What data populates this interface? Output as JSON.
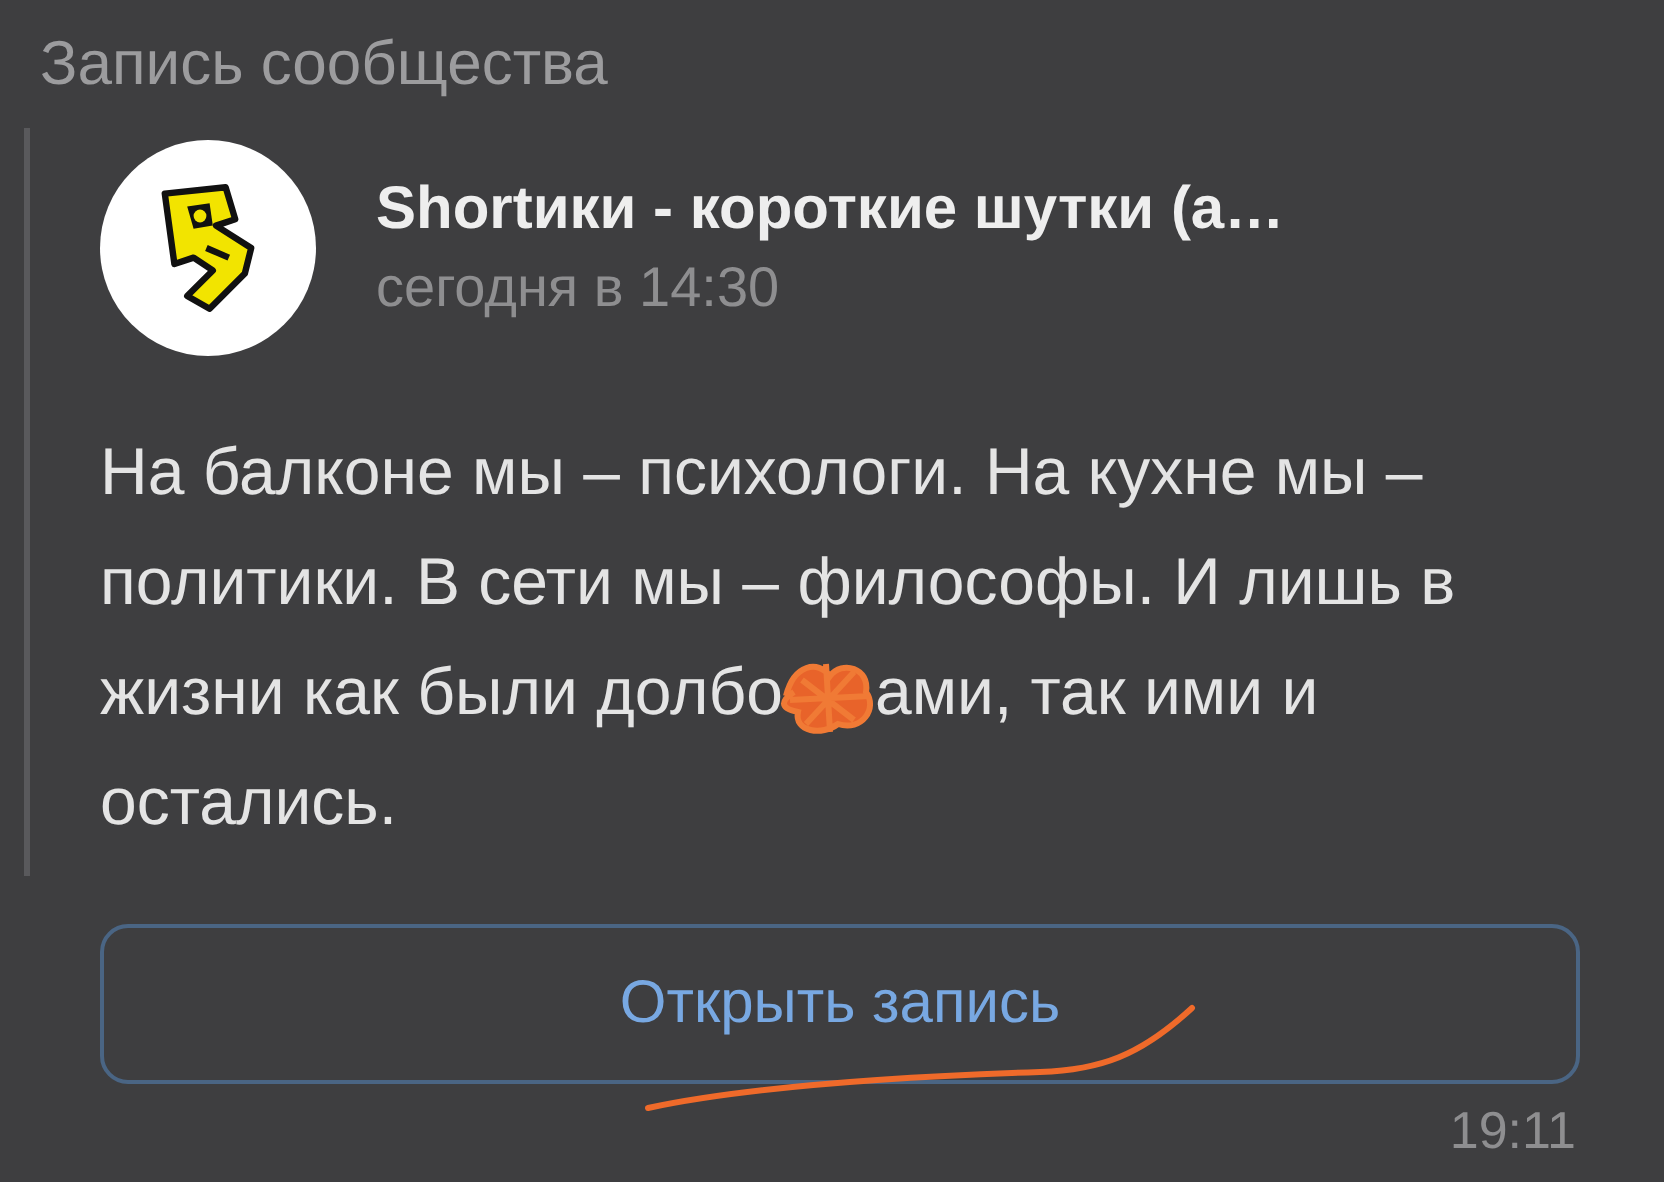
{
  "title": "Запись сообщества",
  "post": {
    "author": "Shortики - короткие шутки (а…",
    "date": "сегодня в 14:30",
    "text_parts": [
      "На балконе мы – психологи. На кухне мы – политики. В сети мы – философы. И лишь в жизни как были долбо",
      "ами, так ими и остались."
    ]
  },
  "open_button": "Открыть запись",
  "time": "19:11"
}
